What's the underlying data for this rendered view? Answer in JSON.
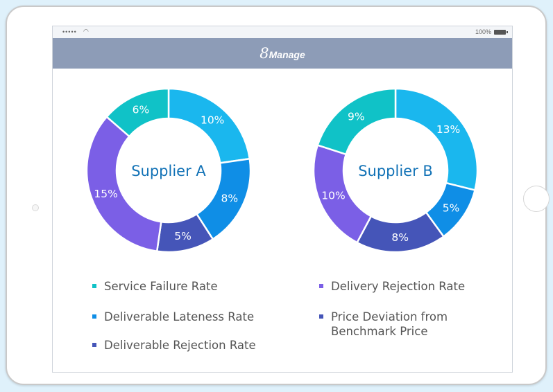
{
  "status_bar": {
    "signal": "•••••",
    "battery": "100%"
  },
  "app": {
    "brand_number": "8",
    "brand_name": "Manage"
  },
  "colors": {
    "service_failure": "#10c2c7",
    "deliverable_lateness": "#0f8ee6",
    "deliverable_rejection": "#4555b8",
    "delivery_rejection": "#7b5fe6",
    "price_deviation": "#4555b8",
    "light_blue": "#1ab7ee"
  },
  "legend": [
    {
      "label": "Service Failure Rate",
      "color": "#10c2c7"
    },
    {
      "label": "Deliverable Lateness Rate",
      "color": "#0f8ee6"
    },
    {
      "label": "Deliverable Rejection Rate",
      "color": "#4555b8"
    },
    {
      "label": "Delivery Rejection Rate",
      "color": "#7b5fe6"
    },
    {
      "label": "Price Deviation from Benchmark Price",
      "color": "#4555b8"
    }
  ],
  "chart_data": [
    {
      "type": "pie",
      "title": "Supplier A",
      "slices": [
        {
          "label": "10%",
          "value": 10,
          "color": "#1ab7ee"
        },
        {
          "label": "8%",
          "value": 8,
          "color": "#0f8ee6"
        },
        {
          "label": "5%",
          "value": 5,
          "color": "#4555b8"
        },
        {
          "label": "15%",
          "value": 15,
          "color": "#7b5fe6"
        },
        {
          "label": "6%",
          "value": 6,
          "color": "#10c2c7"
        }
      ]
    },
    {
      "type": "pie",
      "title": "Supplier B",
      "slices": [
        {
          "label": "13%",
          "value": 13,
          "color": "#1ab7ee"
        },
        {
          "label": "5%",
          "value": 5,
          "color": "#0f8ee6"
        },
        {
          "label": "8%",
          "value": 8,
          "color": "#4555b8"
        },
        {
          "label": "10%",
          "value": 10,
          "color": "#7b5fe6"
        },
        {
          "label": "9%",
          "value": 9,
          "color": "#10c2c7"
        }
      ]
    }
  ]
}
